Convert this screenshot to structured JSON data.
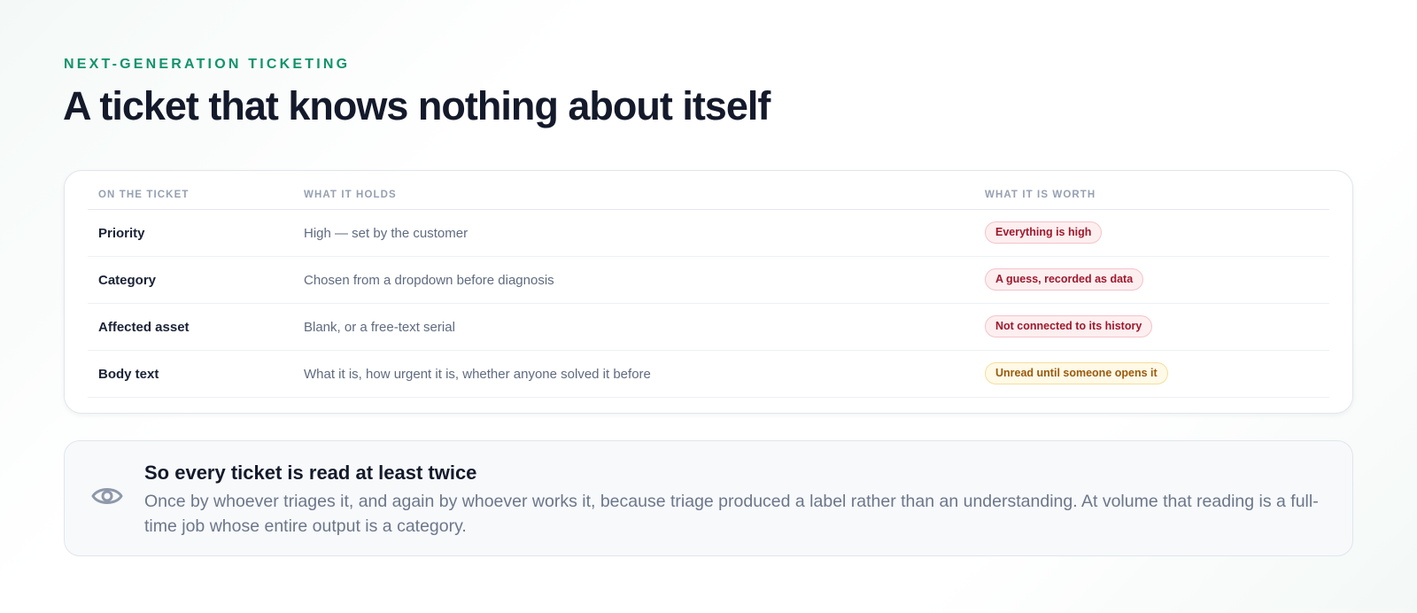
{
  "header": {
    "eyebrow": "NEXT-GENERATION TICKETING",
    "title": "A ticket that knows nothing about itself"
  },
  "table": {
    "columns": [
      "ON THE TICKET",
      "WHAT IT HOLDS",
      "WHAT IT IS WORTH"
    ],
    "rows": [
      {
        "field": "Priority",
        "holds": "High — set by the customer",
        "worth": "Everything is high",
        "tone": "red"
      },
      {
        "field": "Category",
        "holds": "Chosen from a dropdown before diagnosis",
        "worth": "A guess, recorded as data",
        "tone": "red"
      },
      {
        "field": "Affected asset",
        "holds": "Blank, or a free-text serial",
        "worth": "Not connected to its history",
        "tone": "red"
      },
      {
        "field": "Body text",
        "holds": "What it is, how urgent it is, whether anyone solved it before",
        "worth": "Unread until someone opens it",
        "tone": "amber"
      }
    ]
  },
  "callout": {
    "icon": "eye-icon",
    "title": "So every ticket is read at least twice",
    "body": "Once by whoever triages it, and again by whoever works it, because triage produced a label rather than an understanding. At volume that reading is a full-time job whose entire output is a category."
  },
  "colors": {
    "accent": "#12936b",
    "badge_red": "#a0182c",
    "badge_amber": "#9a5a0c"
  }
}
